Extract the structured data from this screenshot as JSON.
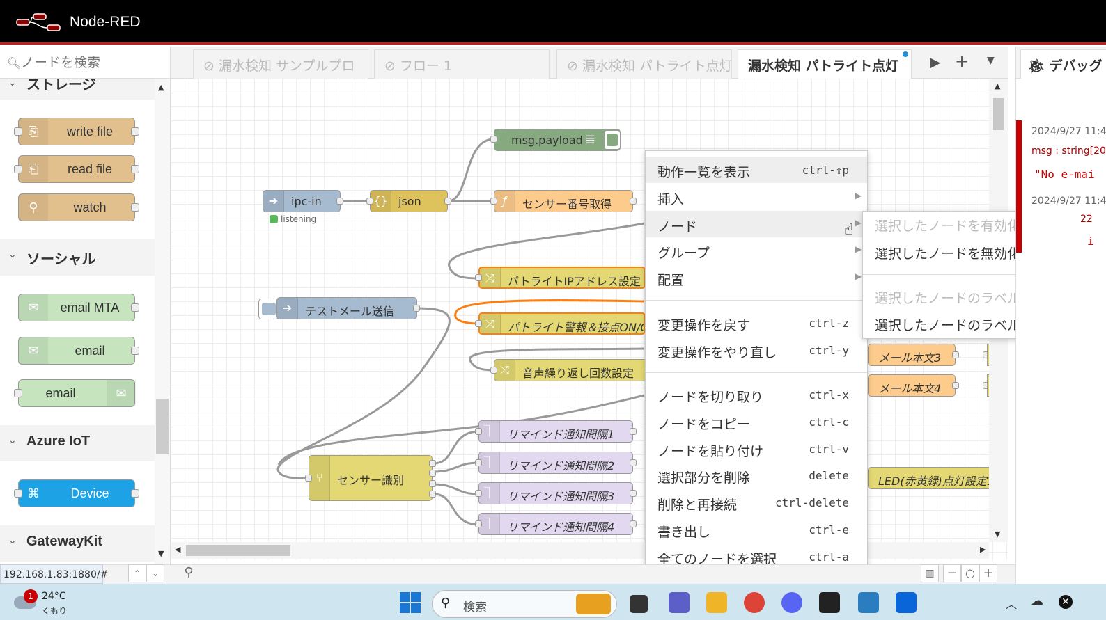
{
  "app": {
    "title": "Node-RED"
  },
  "palette": {
    "search_placeholder": "ノードを検索",
    "categories": [
      {
        "label": "ストレージ"
      },
      {
        "label": "ソーシャル"
      },
      {
        "label": "Azure IoT"
      },
      {
        "label": "GatewayKit"
      }
    ],
    "nodes": {
      "write_file": "write file",
      "read_file": "read file",
      "watch": "watch",
      "email_mta": "email MTA",
      "email_in": "email",
      "email_out": "email",
      "device": "Device"
    }
  },
  "tabs": [
    {
      "label": "漏水検知 サンプルプロ",
      "disabled": true
    },
    {
      "label": "フロー 1",
      "disabled": true
    },
    {
      "label": "漏水検知 パトライト点灯",
      "disabled": true
    },
    {
      "label": "漏水検知 パトライト点灯",
      "active": true
    }
  ],
  "flow_nodes": {
    "msg_payload": "msg.payload",
    "ipc_in": "ipc-in",
    "ipc_in_status": "listening",
    "json": "json",
    "sensor_no": "センサー番号取得",
    "patlite_ip": "パトライトIPアドレス設定",
    "test_mail": "テストメール送信",
    "patlite_alarm": "パトライト警報＆接点ON/Off",
    "voice_repeat": "音声繰り返し回数設定",
    "mail_body3": "メール本文3",
    "mail_body4": "メール本文4",
    "remind1": "リマインド通知間隔1",
    "remind2": "リマインド通知間隔2",
    "remind3": "リマインド通知間隔3",
    "remind4": "リマインド通知間隔4",
    "sensor_switch": "センサー識別",
    "led_setting": "LED(赤黄緑)点灯設定1"
  },
  "context_menu": {
    "items": [
      {
        "label": "動作一覧を表示",
        "key": "ctrl-⇧p"
      },
      {
        "label": "挿入",
        "submenu": true
      },
      {
        "label": "ノード",
        "submenu": true
      },
      {
        "label": "グループ",
        "submenu": true
      },
      {
        "label": "配置",
        "submenu": true
      },
      {
        "label": "変更操作を戻す",
        "key": "ctrl-z"
      },
      {
        "label": "変更操作をやり直し",
        "key": "ctrl-y"
      },
      {
        "label": "ノードを切り取り",
        "key": "ctrl-x"
      },
      {
        "label": "ノードをコピー",
        "key": "ctrl-c"
      },
      {
        "label": "ノードを貼り付け",
        "key": "ctrl-v"
      },
      {
        "label": "選択部分を削除",
        "key": "delete"
      },
      {
        "label": "削除と再接続",
        "key": "ctrl-delete"
      },
      {
        "label": "書き出し",
        "key": "ctrl-e"
      },
      {
        "label": "全てのノードを選択",
        "key": "ctrl-a"
      }
    ]
  },
  "submenu": {
    "items": [
      {
        "label": "選択したノードを有効化",
        "disabled": true
      },
      {
        "label": "選択したノードを無効化"
      },
      {
        "label": "選択したノードのラベル表示",
        "disabled": true
      },
      {
        "label": "選択したノードのラベル非表示"
      }
    ]
  },
  "sidebar": {
    "tab_label": "デバッグ",
    "messages": [
      {
        "timestamp": "2024/9/27 11:4",
        "topic": "msg : string[20",
        "value": "\"No e-mai"
      },
      {
        "timestamp": "2024/9/27 11:4",
        "topic": "22",
        "value": "i"
      }
    ]
  },
  "statusbar": {
    "url": "192.168.1.83:1880/#"
  },
  "taskbar": {
    "weather_temp": "24°C",
    "weather_desc": "くもり",
    "weather_badge": "1",
    "search_label": "検索"
  },
  "colors": {
    "header_bg": "#000000",
    "header_accent": "#c02020",
    "storage_node": "#e2c08d",
    "social_node": "#c6e5bf",
    "azure_node": "#1ea2e6",
    "function_node": "#fdcc8c",
    "change_node": "#e3d873",
    "debug_node": "#87a980",
    "link_node": "#a6bbcf",
    "wire_selected": "#ff7f0e"
  }
}
